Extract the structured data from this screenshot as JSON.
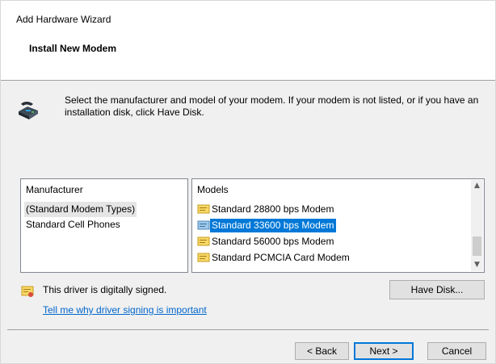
{
  "window": {
    "title": "Add Hardware Wizard",
    "page_title": "Install New Modem"
  },
  "instructions": "Select the manufacturer and model of your modem. If your modem is not listed, or if you have an installation disk, click Have Disk.",
  "manufacturer": {
    "header": "Manufacturer",
    "items": [
      "(Standard Modem Types)",
      "Standard Cell Phones"
    ],
    "selected": "(Standard Modem Types)"
  },
  "models": {
    "header": "Models",
    "items": [
      "Standard 28800 bps Modem",
      "Standard 33600 bps Modem",
      "Standard 56000 bps Modem",
      "Standard PCMCIA Card Modem"
    ],
    "selected": "Standard 33600 bps Modem"
  },
  "signing": {
    "status": "This driver is digitally signed.",
    "link": "Tell me why driver signing is important"
  },
  "buttons": {
    "have_disk": "Have Disk...",
    "back": "< Back",
    "next": "Next >",
    "cancel": "Cancel"
  },
  "colors": {
    "selection": "#0078d7",
    "link": "#0066cc",
    "dialog_background": "#f0f0f0"
  }
}
